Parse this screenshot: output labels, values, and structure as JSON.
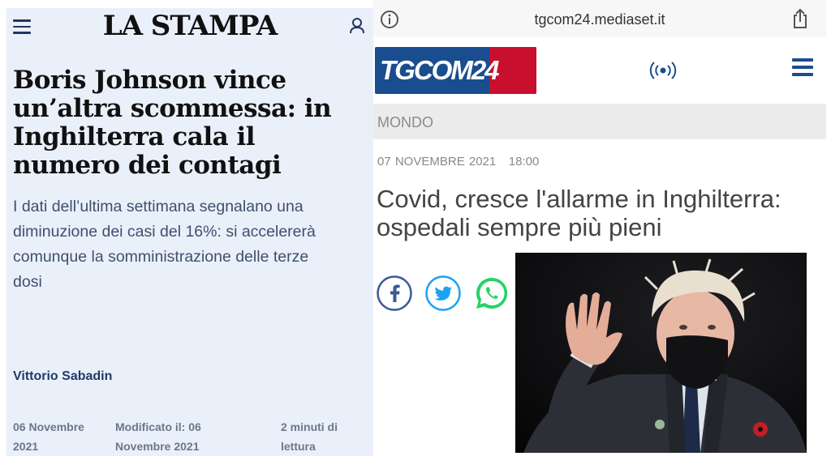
{
  "left_panel": {
    "logo": "LA STAMPA",
    "headline_lines": [
      "Boris Johnson vince",
      "un’altra scommessa: in",
      "Inghilterra cala il",
      "numero dei contagi"
    ],
    "subtitle_lines": [
      "I dati dell’ultima settimana segnalano una",
      "diminuzione dei casi del 16%: si accelererà",
      "comunque la somministrazione delle terze",
      "dosi"
    ],
    "author": "Vittorio Sabadin",
    "date_lines": [
      "06 Novembre",
      "2021"
    ],
    "modified_lines": [
      "Modificato il: 06",
      "Novembre 2021"
    ],
    "reading_lines": [
      "2 minuti di",
      "lettura"
    ],
    "colors": {
      "background": "#eaf0fa",
      "author": "#1f3b68",
      "subtitle": "#3f4f6e"
    }
  },
  "right_panel": {
    "url": "tgcom24.mediaset.it",
    "logo": "TGCOM24",
    "section": "MONDO",
    "date": "07 NOVEMBRE 2021",
    "time": "18:00",
    "headline_lines": [
      "Covid, cresce l'allarme in Inghilterra:",
      "ospedali sempre più pieni"
    ],
    "social_icons": [
      "facebook-icon",
      "twitter-icon",
      "whatsapp-icon"
    ],
    "colors": {
      "brand_blue": "#1a4d8f",
      "brand_red": "#c8102e",
      "facebook": "#3b5998",
      "twitter": "#1da1f2",
      "whatsapp": "#25d366"
    }
  }
}
